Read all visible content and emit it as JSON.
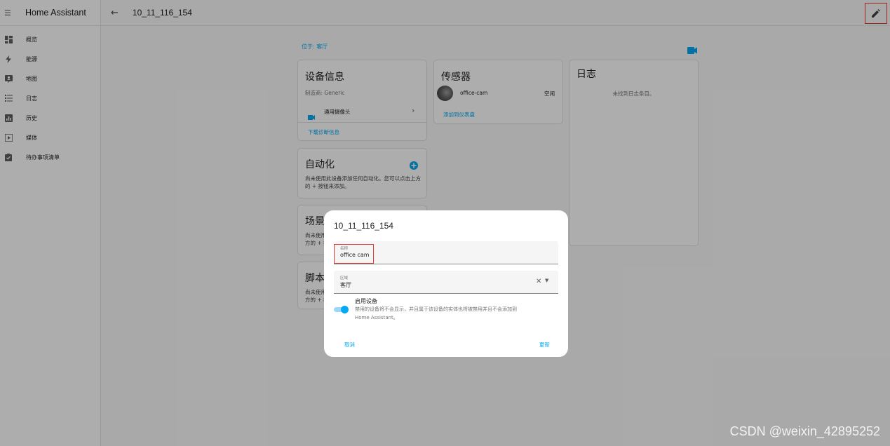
{
  "app": {
    "title": "Home Assistant"
  },
  "sidebar": {
    "items": [
      {
        "label": "概览",
        "icon": "dashboard-icon"
      },
      {
        "label": "能源",
        "icon": "lightning-icon"
      },
      {
        "label": "地图",
        "icon": "map-icon"
      },
      {
        "label": "日志",
        "icon": "logbook-icon"
      },
      {
        "label": "历史",
        "icon": "history-icon"
      },
      {
        "label": "媒体",
        "icon": "media-icon"
      },
      {
        "label": "待办事项清单",
        "icon": "clipboard-icon"
      }
    ]
  },
  "page": {
    "title": "10_11_116_154",
    "location": "位于: 客厅"
  },
  "device_info": {
    "title": "设备信息",
    "manufacturer": "制造商: Generic",
    "entity": "通用摄像头",
    "download": "下载诊断信息"
  },
  "sensors": {
    "title": "传感器",
    "item_name": "office-cam",
    "item_state": "空闲",
    "add": "添加到仪表盘"
  },
  "logbook": {
    "title": "日志",
    "empty": "未找到日志条目。"
  },
  "automation": {
    "title": "自动化",
    "text": "尚未使用此设备添加任何自动化。您可以点击上方的 + 按钮来添加。"
  },
  "scene": {
    "title": "场景",
    "text_1": "尚未使用",
    "text_2": "方的 + 按"
  },
  "script": {
    "title": "脚本",
    "text_1": "尚未使用",
    "text_2": "方的 + 按"
  },
  "dialog": {
    "title": "10_11_116_154",
    "name_label": "名称",
    "name_value": "office cam",
    "area_label": "区域",
    "area_value": "客厅",
    "enable_title": "启用设备",
    "enable_desc_1": "禁用的设备将不会显示，并且属于该设备的实体也将被禁用并且不会添加到",
    "enable_desc_2": "Home Assistant。",
    "cancel": "取消",
    "update": "更新"
  },
  "watermark": "CSDN @weixin_42895252",
  "colors": {
    "accent": "#03a9f4",
    "highlight": "#e53935"
  }
}
